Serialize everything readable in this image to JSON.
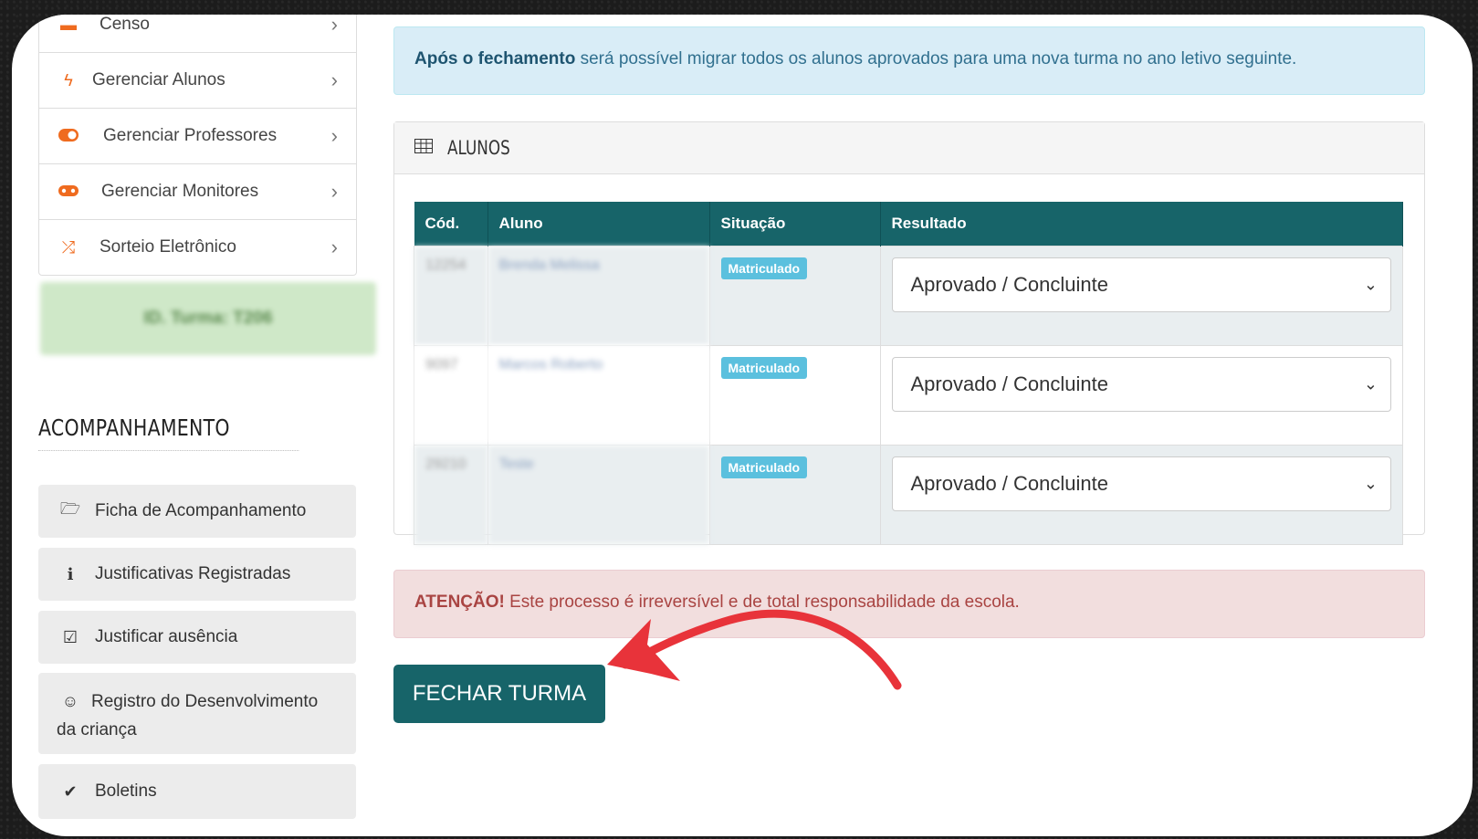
{
  "sidebar": {
    "menu": [
      {
        "label": "Censo",
        "icon": "census-icon"
      },
      {
        "label": "Gerenciar Alunos",
        "icon": "bolt-icon"
      },
      {
        "label": "Gerenciar Professores",
        "icon": "toggle-icon"
      },
      {
        "label": "Gerenciar Monitores",
        "icon": "gamepad-icon"
      },
      {
        "label": "Sorteio Eletrônico",
        "icon": "shuffle-icon"
      }
    ],
    "turma_id": "ID. Turma: T206",
    "section_title": "ACOMPANHAMENTO",
    "buttons": [
      {
        "label": "Ficha de Acompanhamento",
        "icon": "folder-open-icon"
      },
      {
        "label": "Justificativas Registradas",
        "icon": "info-icon"
      },
      {
        "label": "Justificar ausência",
        "icon": "check-square-icon"
      },
      {
        "label": "Registro do Desenvolvimento da criança",
        "icon": "smile-icon"
      },
      {
        "label": "Boletins",
        "icon": "check-icon"
      }
    ]
  },
  "info_alert": {
    "strong": "Após o fechamento",
    "text": " será possível migrar todos os alunos aprovados para uma nova turma no ano letivo seguinte."
  },
  "panel": {
    "title": "ALUNOS",
    "columns": [
      "Cód.",
      "Aluno",
      "Situação",
      "Resultado"
    ],
    "rows": [
      {
        "cod": "12254",
        "aluno": "Brenda Melissa",
        "situacao": "Matriculado",
        "resultado": "Aprovado / Concluinte"
      },
      {
        "cod": "9097",
        "aluno": "Marcos Roberto",
        "situacao": "Matriculado",
        "resultado": "Aprovado / Concluinte"
      },
      {
        "cod": "29210",
        "aluno": "Teste",
        "situacao": "Matriculado",
        "resultado": "Aprovado / Concluinte"
      }
    ]
  },
  "danger_alert": {
    "strong": "ATENÇÃO!",
    "text": " Este processo é irreversível e de total responsabilidade da escola."
  },
  "close_button": "FECHAR TURMA",
  "colors": {
    "primary": "#176469",
    "accent": "#ef6b1f",
    "badge": "#5bc0de",
    "arrow": "#e8333a"
  }
}
